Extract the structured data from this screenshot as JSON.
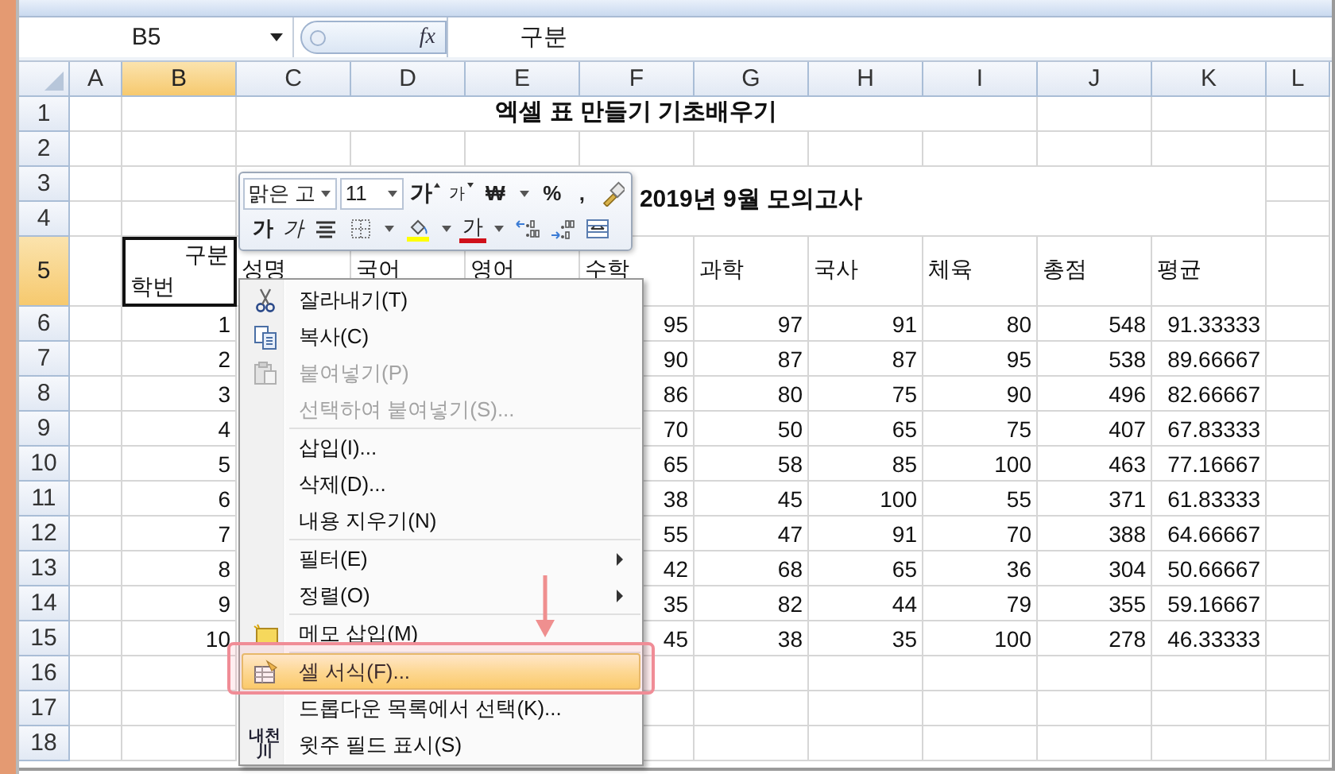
{
  "name_box": {
    "value": "B5"
  },
  "formula_bar": {
    "function_label": "fx",
    "value": "구분"
  },
  "columns": [
    {
      "label": "A",
      "selected": false
    },
    {
      "label": "B",
      "selected": true
    },
    {
      "label": "C",
      "selected": false
    },
    {
      "label": "D",
      "selected": false
    },
    {
      "label": "E",
      "selected": false
    },
    {
      "label": "F",
      "selected": false
    },
    {
      "label": "G",
      "selected": false
    },
    {
      "label": "H",
      "selected": false
    },
    {
      "label": "I",
      "selected": false
    },
    {
      "label": "J",
      "selected": false
    },
    {
      "label": "K",
      "selected": false
    },
    {
      "label": "L",
      "selected": false
    }
  ],
  "rows": [
    {
      "label": "1",
      "selected": false
    },
    {
      "label": "2",
      "selected": false
    },
    {
      "label": "3",
      "selected": false
    },
    {
      "label": "4",
      "selected": false
    },
    {
      "label": "5",
      "selected": true
    },
    {
      "label": "6",
      "selected": false
    },
    {
      "label": "7",
      "selected": false
    },
    {
      "label": "8",
      "selected": false
    },
    {
      "label": "9",
      "selected": false
    },
    {
      "label": "10",
      "selected": false
    },
    {
      "label": "11",
      "selected": false
    },
    {
      "label": "12",
      "selected": false
    },
    {
      "label": "13",
      "selected": false
    },
    {
      "label": "14",
      "selected": false
    },
    {
      "label": "15",
      "selected": false
    },
    {
      "label": "16",
      "selected": false
    },
    {
      "label": "17",
      "selected": false
    },
    {
      "label": "18",
      "selected": false
    }
  ],
  "sheet": {
    "title": "엑셀 표 만들기 기초배우기",
    "subtitle": "2019년 9월 모의고사",
    "corner_cell": {
      "top": "구분",
      "bottom": "학번"
    },
    "headers": [
      "성명",
      "국어",
      "영어",
      "수학",
      "과학",
      "국사",
      "체육",
      "총점",
      "평균"
    ],
    "records": [
      {
        "no": "1",
        "values": [
          "95",
          "97",
          "91",
          "80",
          "548",
          "91.33333"
        ]
      },
      {
        "no": "2",
        "values": [
          "90",
          "87",
          "87",
          "95",
          "538",
          "89.66667"
        ]
      },
      {
        "no": "3",
        "values": [
          "86",
          "80",
          "75",
          "90",
          "496",
          "82.66667"
        ]
      },
      {
        "no": "4",
        "values": [
          "70",
          "50",
          "65",
          "75",
          "407",
          "67.83333"
        ]
      },
      {
        "no": "5",
        "values": [
          "65",
          "58",
          "85",
          "100",
          "463",
          "77.16667"
        ]
      },
      {
        "no": "6",
        "values": [
          "38",
          "45",
          "100",
          "55",
          "371",
          "61.83333"
        ]
      },
      {
        "no": "7",
        "values": [
          "55",
          "47",
          "91",
          "70",
          "388",
          "64.66667"
        ]
      },
      {
        "no": "8",
        "values": [
          "42",
          "68",
          "65",
          "36",
          "304",
          "50.66667"
        ]
      },
      {
        "no": "9",
        "values": [
          "35",
          "82",
          "44",
          "79",
          "355",
          "59.16667"
        ]
      },
      {
        "no": "10",
        "values": [
          "45",
          "38",
          "35",
          "100",
          "278",
          "46.33333"
        ]
      }
    ]
  },
  "mini_toolbar": {
    "font": "맑은 고",
    "size": "11",
    "rows": [
      [
        {
          "kind": "grow",
          "label": "가",
          "dropdown": false
        },
        {
          "kind": "shrink",
          "label": "가",
          "dropdown": false
        },
        {
          "kind": "currency",
          "label": "₩",
          "dropdown": true
        },
        {
          "kind": "percent",
          "label": "%",
          "dropdown": false
        },
        {
          "kind": "comma",
          "label": ",",
          "dropdown": false
        },
        {
          "kind": "painter",
          "dropdown": false
        }
      ],
      [
        {
          "kind": "bold",
          "label": "가",
          "dropdown": false
        },
        {
          "kind": "italic",
          "label": "가",
          "dropdown": false
        },
        {
          "kind": "center",
          "dropdown": false
        },
        {
          "kind": "borders",
          "dropdown": true
        },
        {
          "kind": "fill",
          "dropdown": true
        },
        {
          "kind": "fontcolor",
          "label": "가",
          "dropdown": true
        },
        {
          "kind": "incdecimal",
          "dropdown": false
        },
        {
          "kind": "decdecimal",
          "dropdown": false
        },
        {
          "kind": "merge",
          "dropdown": false
        }
      ]
    ]
  },
  "context_menu": {
    "items": [
      {
        "kind": "cut",
        "label": "잘라내기(T)",
        "disabled": false,
        "submenu": false,
        "selected": false
      },
      {
        "kind": "copy",
        "label": "복사(C)",
        "disabled": false,
        "submenu": false,
        "selected": false
      },
      {
        "kind": "paste",
        "label": "붙여넣기(P)",
        "disabled": true,
        "submenu": false,
        "selected": false
      },
      {
        "kind": "item",
        "label": "선택하여 붙여넣기(S)...",
        "disabled": true,
        "submenu": false,
        "selected": false
      },
      {
        "kind": "separator"
      },
      {
        "kind": "item",
        "label": "삽입(I)...",
        "disabled": false,
        "submenu": false,
        "selected": false
      },
      {
        "kind": "item",
        "label": "삭제(D)...",
        "disabled": false,
        "submenu": false,
        "selected": false
      },
      {
        "kind": "item",
        "label": "내용 지우기(N)",
        "disabled": false,
        "submenu": false,
        "selected": false
      },
      {
        "kind": "separator"
      },
      {
        "kind": "item",
        "label": "필터(E)",
        "disabled": false,
        "submenu": true,
        "selected": false
      },
      {
        "kind": "item",
        "label": "정렬(O)",
        "disabled": false,
        "submenu": true,
        "selected": false
      },
      {
        "kind": "separator"
      },
      {
        "kind": "memo",
        "label": "메모 삽입(M)",
        "disabled": false,
        "submenu": false,
        "selected": false
      },
      {
        "kind": "separator"
      },
      {
        "kind": "format",
        "label": "셀 서식(F)...",
        "disabled": false,
        "submenu": false,
        "selected": true
      },
      {
        "kind": "item",
        "label": "드롭다운 목록에서 선택(K)...",
        "disabled": false,
        "submenu": false,
        "selected": false
      },
      {
        "kind": "phonetic",
        "label": "윗주 필드 표시(S)",
        "icon_text": [
          "내천",
          "川"
        ],
        "disabled": false,
        "submenu": false,
        "selected": false
      }
    ]
  }
}
